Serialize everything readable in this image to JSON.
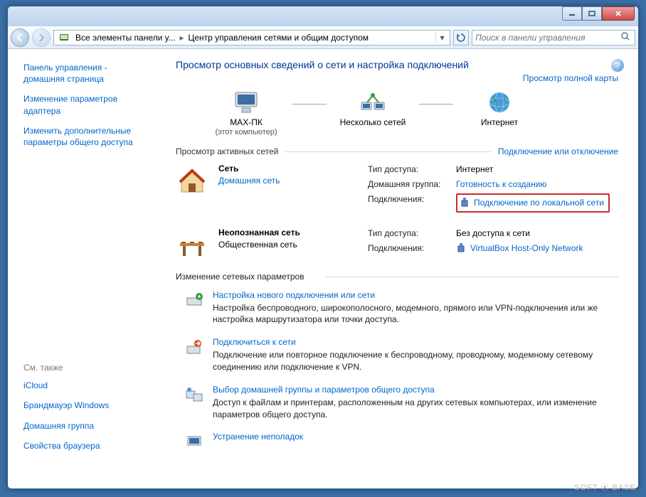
{
  "breadcrumb": {
    "seg1": "Все элементы панели у...",
    "seg2": "Центр управления сетями и общим доступом"
  },
  "search": {
    "placeholder": "Поиск в панели управления"
  },
  "sidebar": {
    "home": "Панель управления - домашняя страница",
    "adapter": "Изменение параметров адаптера",
    "sharing": "Изменить дополнительные параметры общего доступа",
    "see_also": "См. также",
    "links": {
      "icloud": "iCloud",
      "firewall": "Брандмауэр Windows",
      "homegroup": "Домашняя группа",
      "browser": "Свойства браузера"
    }
  },
  "main": {
    "title": "Просмотр основных сведений о сети и настройка подключений",
    "full_map": "Просмотр полной карты",
    "diagram": {
      "node1": "MAX-ПК",
      "node1_sub": "(этот компьютер)",
      "node2": "Несколько сетей",
      "node3": "Интернет"
    },
    "active_header": "Просмотр активных сетей",
    "connect_link": "Подключение или отключение",
    "net1": {
      "name": "Сеть",
      "type": "Домашняя сеть",
      "labels": {
        "access": "Тип доступа:",
        "homegroup": "Домашняя группа:",
        "conn": "Подключения:"
      },
      "values": {
        "access": "Интернет",
        "homegroup": "Готовность к созданию",
        "conn": "Подключение по локальной сети"
      }
    },
    "net2": {
      "name": "Неопознанная сеть",
      "type": "Общественная сеть",
      "labels": {
        "access": "Тип доступа:",
        "conn": "Подключения:"
      },
      "values": {
        "access": "Без доступа к сети",
        "conn": "VirtualBox Host-Only Network"
      }
    },
    "settings_header": "Изменение сетевых параметров",
    "s1": {
      "title": "Настройка нового подключения или сети",
      "desc": "Настройка беспроводного, широкополосного, модемного, прямого или VPN-подключения или же настройка маршрутизатора или точки доступа."
    },
    "s2": {
      "title": "Подключиться к сети",
      "desc": "Подключение или повторное подключение к беспроводному, проводному, модемному сетевому соединению или подключение к VPN."
    },
    "s3": {
      "title": "Выбор домашней группы и параметров общего доступа",
      "desc": "Доступ к файлам и принтерам, расположенным на других сетевых компьютерах, или изменение параметров общего доступа."
    },
    "s4": {
      "title": "Устранение неполадок"
    }
  },
  "watermark": "SOFT ⦿ BASE"
}
